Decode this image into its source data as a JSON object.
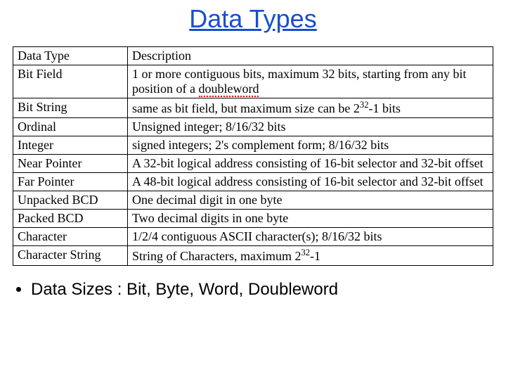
{
  "title": "Data Types",
  "table": {
    "header": {
      "type": "Data Type",
      "desc": "Description"
    },
    "rows": [
      {
        "type": "Bit Field",
        "desc_part1": "1 or more contiguous bits, maximum 32 bits, starting from any bit position of a ",
        "desc_squiggle": "doubleword"
      },
      {
        "type": "Bit String",
        "desc_part1": "same as bit field, but maximum size can be 2",
        "desc_sup": "32",
        "desc_part2": "-1 bits"
      },
      {
        "type": "Ordinal",
        "desc": "Unsigned integer; 8/16/32 bits"
      },
      {
        "type": "Integer",
        "desc": "signed integers; 2's complement form; 8/16/32 bits"
      },
      {
        "type": "Near Pointer",
        "desc": "A 32-bit logical address consisting of 16-bit selector and 32-bit offset"
      },
      {
        "type": "Far Pointer",
        "desc": "A 48-bit logical address consisting of 16-bit selector and 32-bit offset"
      },
      {
        "type": "Unpacked BCD",
        "desc": "One decimal digit in one byte"
      },
      {
        "type": "Packed BCD",
        "desc": "Two decimal digits in one byte"
      },
      {
        "type": "Character",
        "desc": "1/2/4 contiguous ASCII character(s); 8/16/32 bits"
      },
      {
        "type": "Character String",
        "desc_part1": "String of Characters, maximum 2",
        "desc_sup": "32",
        "desc_part2": "-1"
      }
    ]
  },
  "bullet": "Data Sizes :  Bit, Byte, Word, Doubleword"
}
